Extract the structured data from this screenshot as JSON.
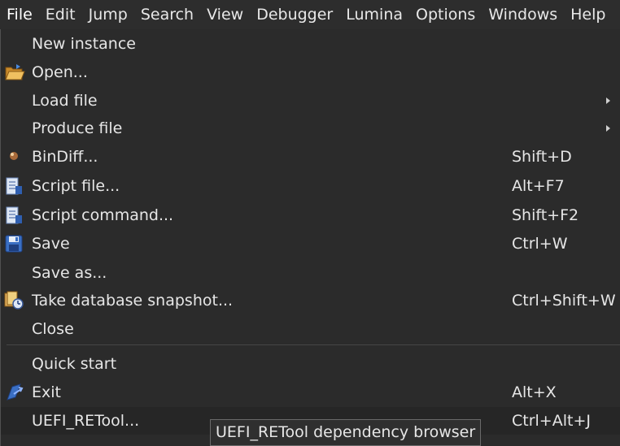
{
  "menubar": {
    "items": [
      "File",
      "Edit",
      "Jump",
      "Search",
      "View",
      "Debugger",
      "Lumina",
      "Options",
      "Windows",
      "Help"
    ]
  },
  "file_menu": {
    "items": [
      {
        "label": "New instance",
        "shortcut": "",
        "icon": "",
        "submenu": false
      },
      {
        "label": "Open...",
        "shortcut": "",
        "icon": "folder-open-icon",
        "submenu": false
      },
      {
        "label": "Load file",
        "shortcut": "",
        "icon": "",
        "submenu": true
      },
      {
        "label": "Produce file",
        "shortcut": "",
        "icon": "",
        "submenu": true
      },
      {
        "label": "BinDiff...",
        "shortcut": "Shift+D",
        "icon": "bindiff-icon",
        "submenu": false
      },
      {
        "label": "Script file...",
        "shortcut": "Alt+F7",
        "icon": "script-file-icon",
        "submenu": false
      },
      {
        "label": "Script command...",
        "shortcut": "Shift+F2",
        "icon": "script-command-icon",
        "submenu": false
      },
      {
        "label": "Save",
        "shortcut": "Ctrl+W",
        "icon": "floppy-disk-icon",
        "submenu": false
      },
      {
        "label": "Save as...",
        "shortcut": "",
        "icon": "",
        "submenu": false
      },
      {
        "label": "Take database snapshot...",
        "shortcut": "Ctrl+Shift+W",
        "icon": "database-snapshot-icon",
        "submenu": false
      },
      {
        "label": "Close",
        "shortcut": "",
        "icon": "",
        "submenu": false
      },
      {
        "label": "Quick start",
        "shortcut": "",
        "icon": "",
        "submenu": false
      },
      {
        "label": "Exit",
        "shortcut": "Alt+X",
        "icon": "exit-icon",
        "submenu": false
      },
      {
        "label": "UEFI_RETool...",
        "shortcut": "Ctrl+Alt+J",
        "icon": "",
        "submenu": false
      }
    ]
  },
  "tooltip": {
    "text": "UEFI_RETool dependency browser"
  },
  "colors": {
    "menu_bg": "#2b2b2b",
    "text": "#e6e6e6",
    "highlight": "#262626"
  }
}
